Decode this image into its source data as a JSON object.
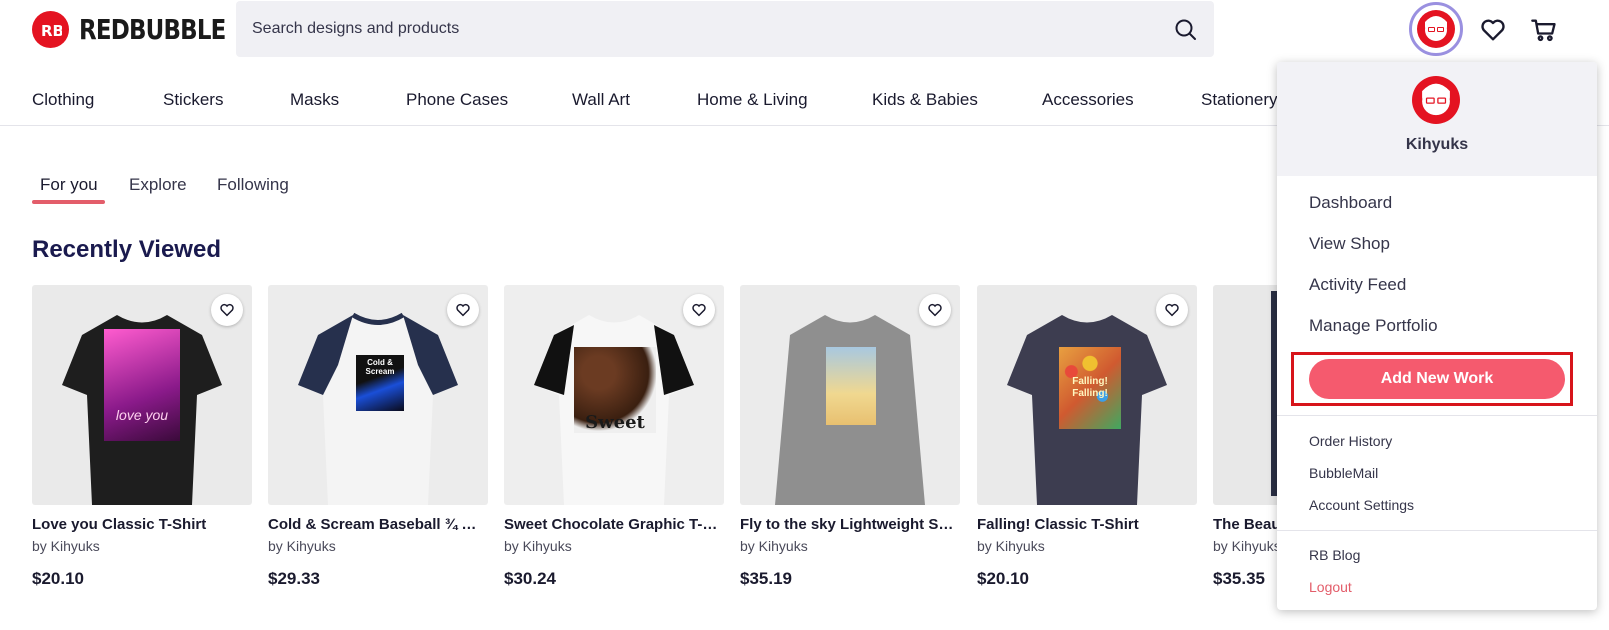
{
  "brand": {
    "name": "REDBUBBLE",
    "logo_mark": "RB"
  },
  "search": {
    "placeholder": "Search designs and products"
  },
  "header_icons": [
    "avatar",
    "heart-icon",
    "cart-icon"
  ],
  "categories": [
    "Clothing",
    "Stickers",
    "Masks",
    "Phone Cases",
    "Wall Art",
    "Home & Living",
    "Kids & Babies",
    "Accessories",
    "Stationery"
  ],
  "tabs": [
    {
      "label": "For you",
      "active": true
    },
    {
      "label": "Explore",
      "active": false
    },
    {
      "label": "Following",
      "active": false
    }
  ],
  "section": {
    "title": "Recently Viewed"
  },
  "products": [
    {
      "title": "Love you Classic T-Shirt",
      "by": "by Kihyuks",
      "price": "$20.10",
      "shirt_color": "#1e1e1e",
      "sleeve_color": "#1e1e1e",
      "print_text": "love you"
    },
    {
      "title": "Cold & Scream Baseball ¾ Sleeve T-Shirt",
      "by": "by Kihyuks",
      "price": "$29.33",
      "shirt_color": "#f4f4f4",
      "sleeve_color": "#26304d",
      "print_text": "Cold & Scream"
    },
    {
      "title": "Sweet Chocolate Graphic T-Shirt",
      "by": "by Kihyuks",
      "price": "$30.24",
      "shirt_color": "#f7f7f7",
      "sleeve_color": "#111111",
      "print_text": "Sweet"
    },
    {
      "title": "Fly to the sky Lightweight Sweatshirt",
      "by": "by Kihyuks",
      "price": "$35.19",
      "shirt_color": "#8f8f8f",
      "sleeve_color": "#8f8f8f",
      "print_text": ""
    },
    {
      "title": "Falling! Classic T-Shirt",
      "by": "by Kihyuks",
      "price": "$20.10",
      "shirt_color": "#3d3d50",
      "sleeve_color": "#3d3d50",
      "print_text": "Falling! Falling!"
    },
    {
      "title": "The Beau",
      "by": "by Kihyuks",
      "price": "$35.35",
      "shirt_color": "#2a2f44",
      "sleeve_color": "#2a2f44",
      "print_text": ""
    }
  ],
  "user_menu": {
    "username": "Kihyuks",
    "primary_items": [
      "Dashboard",
      "View Shop",
      "Activity Feed",
      "Manage Portfolio"
    ],
    "add_button": "Add New Work",
    "secondary_items": [
      "Order History",
      "BubbleMail",
      "Account Settings"
    ],
    "tertiary_items": [
      "RB Blog",
      "Logout"
    ]
  },
  "colors": {
    "brand_red": "#e41321",
    "accent": "#f55a6e",
    "highlight_box": "#d7141a",
    "title_navy": "#1a1a4e"
  }
}
